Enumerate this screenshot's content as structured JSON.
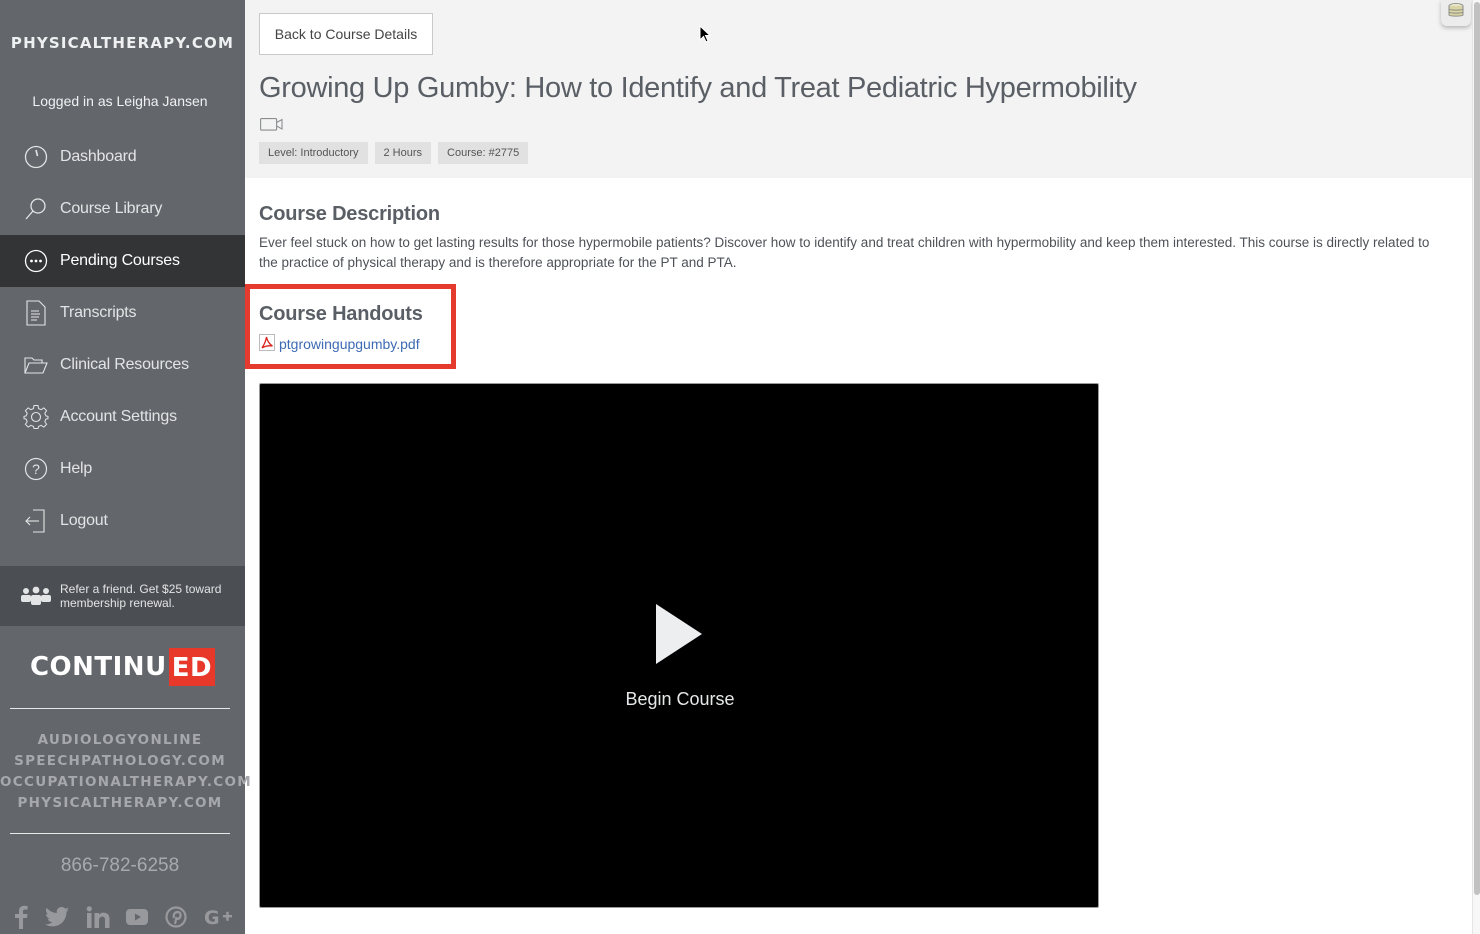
{
  "sidebar": {
    "brand": "PHYSICALTHERAPY.COM",
    "logged_in": "Logged in as Leigha Jansen",
    "items": [
      {
        "label": "Dashboard",
        "icon": "dashboard-clock-icon",
        "active": false
      },
      {
        "label": "Course Library",
        "icon": "search-icon",
        "active": false
      },
      {
        "label": "Pending Courses",
        "icon": "ellipsis-circle-icon",
        "active": true
      },
      {
        "label": "Transcripts",
        "icon": "document-icon",
        "active": false
      },
      {
        "label": "Clinical Resources",
        "icon": "folder-open-icon",
        "active": false
      },
      {
        "label": "Account Settings",
        "icon": "gear-icon",
        "active": false
      },
      {
        "label": "Help",
        "icon": "question-circle-icon",
        "active": false
      },
      {
        "label": "Logout",
        "icon": "logout-icon",
        "active": false
      }
    ],
    "refer_text": "Refer a friend. Get $25 toward membership renewal.",
    "continued_logo": {
      "left": "CONTINU",
      "right": "ED",
      "accent_color": "#e8382a"
    },
    "sites": [
      "AUDIOLOGYONLINE",
      "SPEECHPATHOLOGY.COM",
      "OCCUPATIONALTHERAPY.COM",
      "PHYSICALTHERAPY.COM"
    ],
    "phone": "866-782-6258",
    "social": [
      {
        "name": "facebook",
        "glyph": "f"
      },
      {
        "name": "twitter",
        "glyph": "t"
      },
      {
        "name": "linkedin",
        "glyph": "in"
      },
      {
        "name": "youtube",
        "glyph": "yt"
      },
      {
        "name": "pinterest",
        "glyph": "p"
      },
      {
        "name": "google-plus",
        "glyph": "G+"
      }
    ]
  },
  "main": {
    "back_button": "Back to Course Details",
    "title": "Growing Up Gumby: How to Identify and Treat Pediatric Hypermobility",
    "format_icon": "video-camera-icon",
    "badges": [
      "Level: Introductory",
      "2 Hours",
      "Course: #2775"
    ],
    "description_heading": "Course Description",
    "description": "Ever feel stuck on how to get lasting results for those hypermobile patients? Discover how to identify and treat children with hypermobility and keep them interested. This course is directly related to the practice of physical therapy and is therefore appropriate for the PT and PTA.",
    "handouts_heading": "Course Handouts",
    "handout_file": "ptgrowingupgumby.pdf",
    "player_label": "Begin Course",
    "highlight_color": "#e53a2e",
    "link_color": "#3d6bb3"
  }
}
